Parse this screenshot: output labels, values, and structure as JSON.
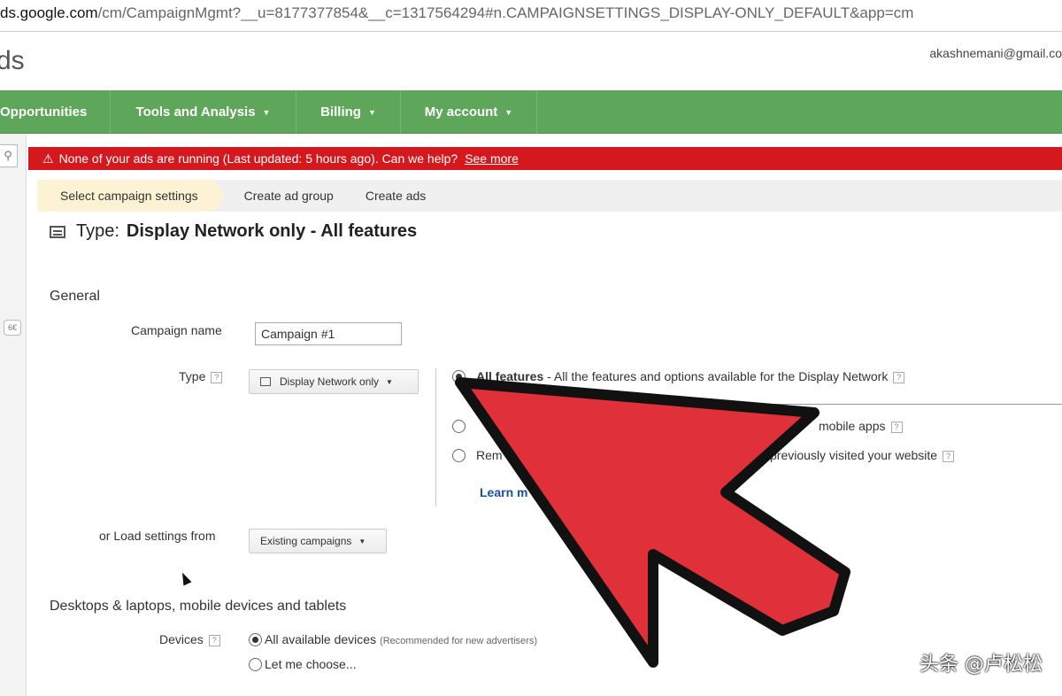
{
  "browser": {
    "url_host": "ds.google.com",
    "url_path": "/cm/CampaignMgmt?__u=8177377854&__c=1317564294#n.CAMPAIGNSETTINGS_DISPLAY-ONLY_DEFAULT&app=cm"
  },
  "header": {
    "logo_fragment": "ds",
    "account_email": "akashnemani@gmail.co"
  },
  "nav": {
    "items": [
      {
        "label": "Opportunities"
      },
      {
        "label": "Tools and Analysis"
      },
      {
        "label": "Billing"
      },
      {
        "label": "My account"
      }
    ]
  },
  "rail": {
    "search_icon": "search-icon",
    "badge_text": "6€"
  },
  "alert": {
    "message": "None of your ads are running (Last updated: 5 hours ago). Can we help?",
    "link": "See more",
    "warn_glyph": "⚠"
  },
  "steps": [
    {
      "label": "Select campaign settings"
    },
    {
      "label": "Create ad group"
    },
    {
      "label": "Create ads"
    }
  ],
  "title": {
    "prefix": "Type:",
    "value": "Display Network only - All features"
  },
  "general": {
    "section": "General",
    "campaign_name_label": "Campaign name",
    "campaign_name_value": "Campaign #1",
    "type_label": "Type",
    "type_dropdown": "Display Network only",
    "help_glyph": "?",
    "options": [
      {
        "bold": "All features",
        "rest": " - All the features and options available for the Display Network"
      },
      {
        "bold": "",
        "rest": "mobile apps"
      },
      {
        "bold": "",
        "rest": "Rem"
      },
      {
        "bold": "",
        "rest": "previously visited your website"
      }
    ],
    "learn_more": "Learn m",
    "load_settings_label": "or Load settings from",
    "load_settings_dropdown": "Existing campaigns"
  },
  "devices": {
    "section": "Desktops & laptops, mobile devices and tablets",
    "label": "Devices",
    "option_all": "All available devices",
    "option_all_note": "(Recommended for new advertisers)",
    "option_choose": "Let me choose..."
  },
  "watermark": "头条 @卢松松",
  "colors": {
    "nav_green": "#5ea65a",
    "alert_red": "#d4181d",
    "arrow_red": "#e0303a"
  }
}
